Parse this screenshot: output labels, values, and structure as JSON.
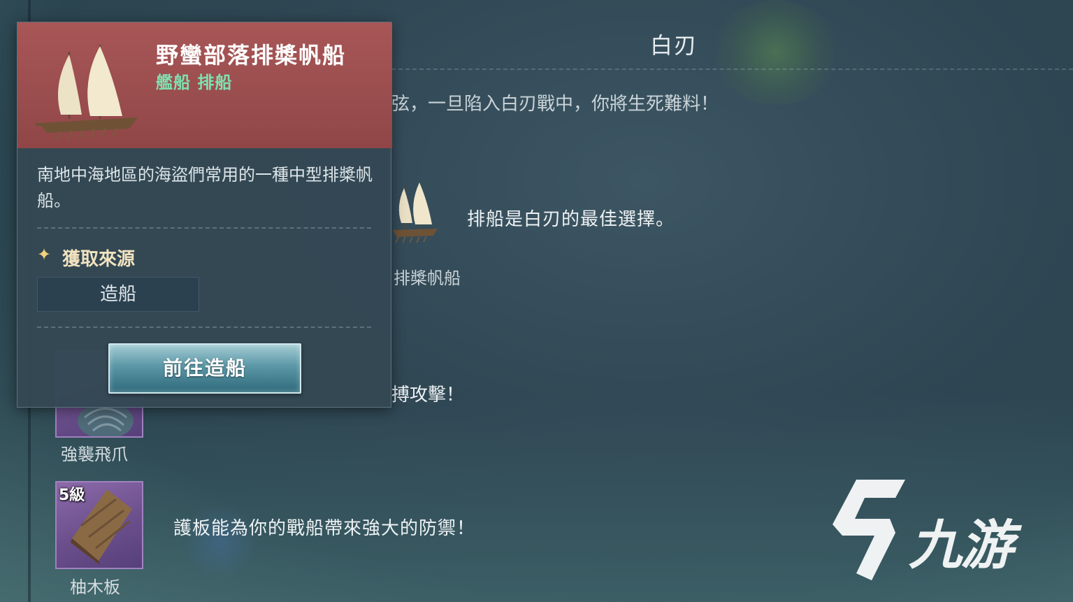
{
  "background_panel": {
    "title": "白刃",
    "intro": "弦，一旦陷入白刃戰中，你將生死難料！",
    "ship": {
      "caption": "排槳帆船",
      "description": "排船是白刃的最佳選擇。"
    },
    "grapple": {
      "description": "搏攻擊！",
      "caption": "強襲飛爪"
    },
    "plank": {
      "level": "5級",
      "caption": "柚木板",
      "description": "護板能為你的戰船帶來強大的防禦！"
    }
  },
  "popup": {
    "ship_name": "野蠻部落排槳帆船",
    "ship_type": "艦船 排船",
    "description": "南地中海地區的海盜們常用的一種中型排槳帆船。",
    "source_heading": "獲取來源",
    "source_item": "造船",
    "goto_button": "前往造船",
    "header_color": "#9a4d4e",
    "type_color": "#7fe0b0"
  },
  "watermark": {
    "text": "九游"
  }
}
